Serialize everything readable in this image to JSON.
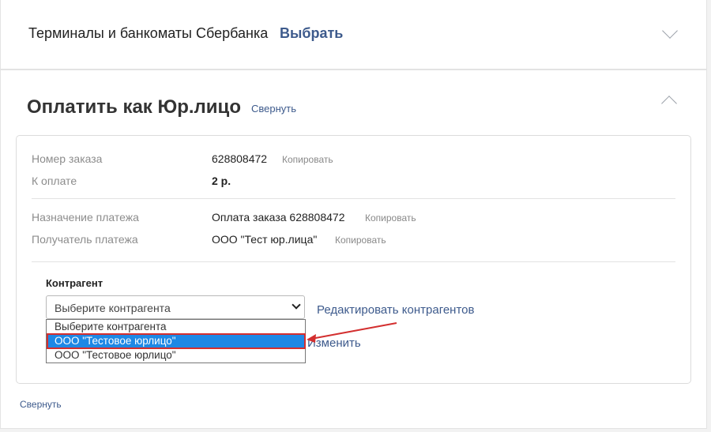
{
  "terminals": {
    "title": "Терминалы и банкоматы Сбербанка",
    "choose_label": "Выбрать",
    "chevron_icon": "chevron-down-icon"
  },
  "legal": {
    "title": "Оплатить как Юр.лицо",
    "collapse_label": "Свернуть",
    "chevron_icon": "chevron-up-icon"
  },
  "order": {
    "number_label": "Номер заказа",
    "number_value": "628808472",
    "number_copy": "Копировать",
    "amount_label": "К оплате",
    "amount_value": "2 р."
  },
  "payment": {
    "purpose_label": "Назначение платежа",
    "purpose_value": "Оплата заказа 628808472",
    "purpose_copy": "Копировать",
    "recipient_label": "Получатель платежа",
    "recipient_value": "ООО \"Тест юр.лица\"",
    "recipient_copy": "Копировать"
  },
  "counterparty": {
    "label": "Контрагент",
    "selected": "Выберите контрагента",
    "edit_label": "Редактировать контрагентов",
    "change_label": "Изменить",
    "options": [
      "Выберите контрагента",
      "ООО \"Тестовое юрлицо\"",
      "ООО \"Тестовое юрлицо\""
    ],
    "highlight_color": "#1e88e5",
    "annotation_color": "#d32f2f"
  },
  "footer": {
    "collapse_label": "Свернуть"
  }
}
